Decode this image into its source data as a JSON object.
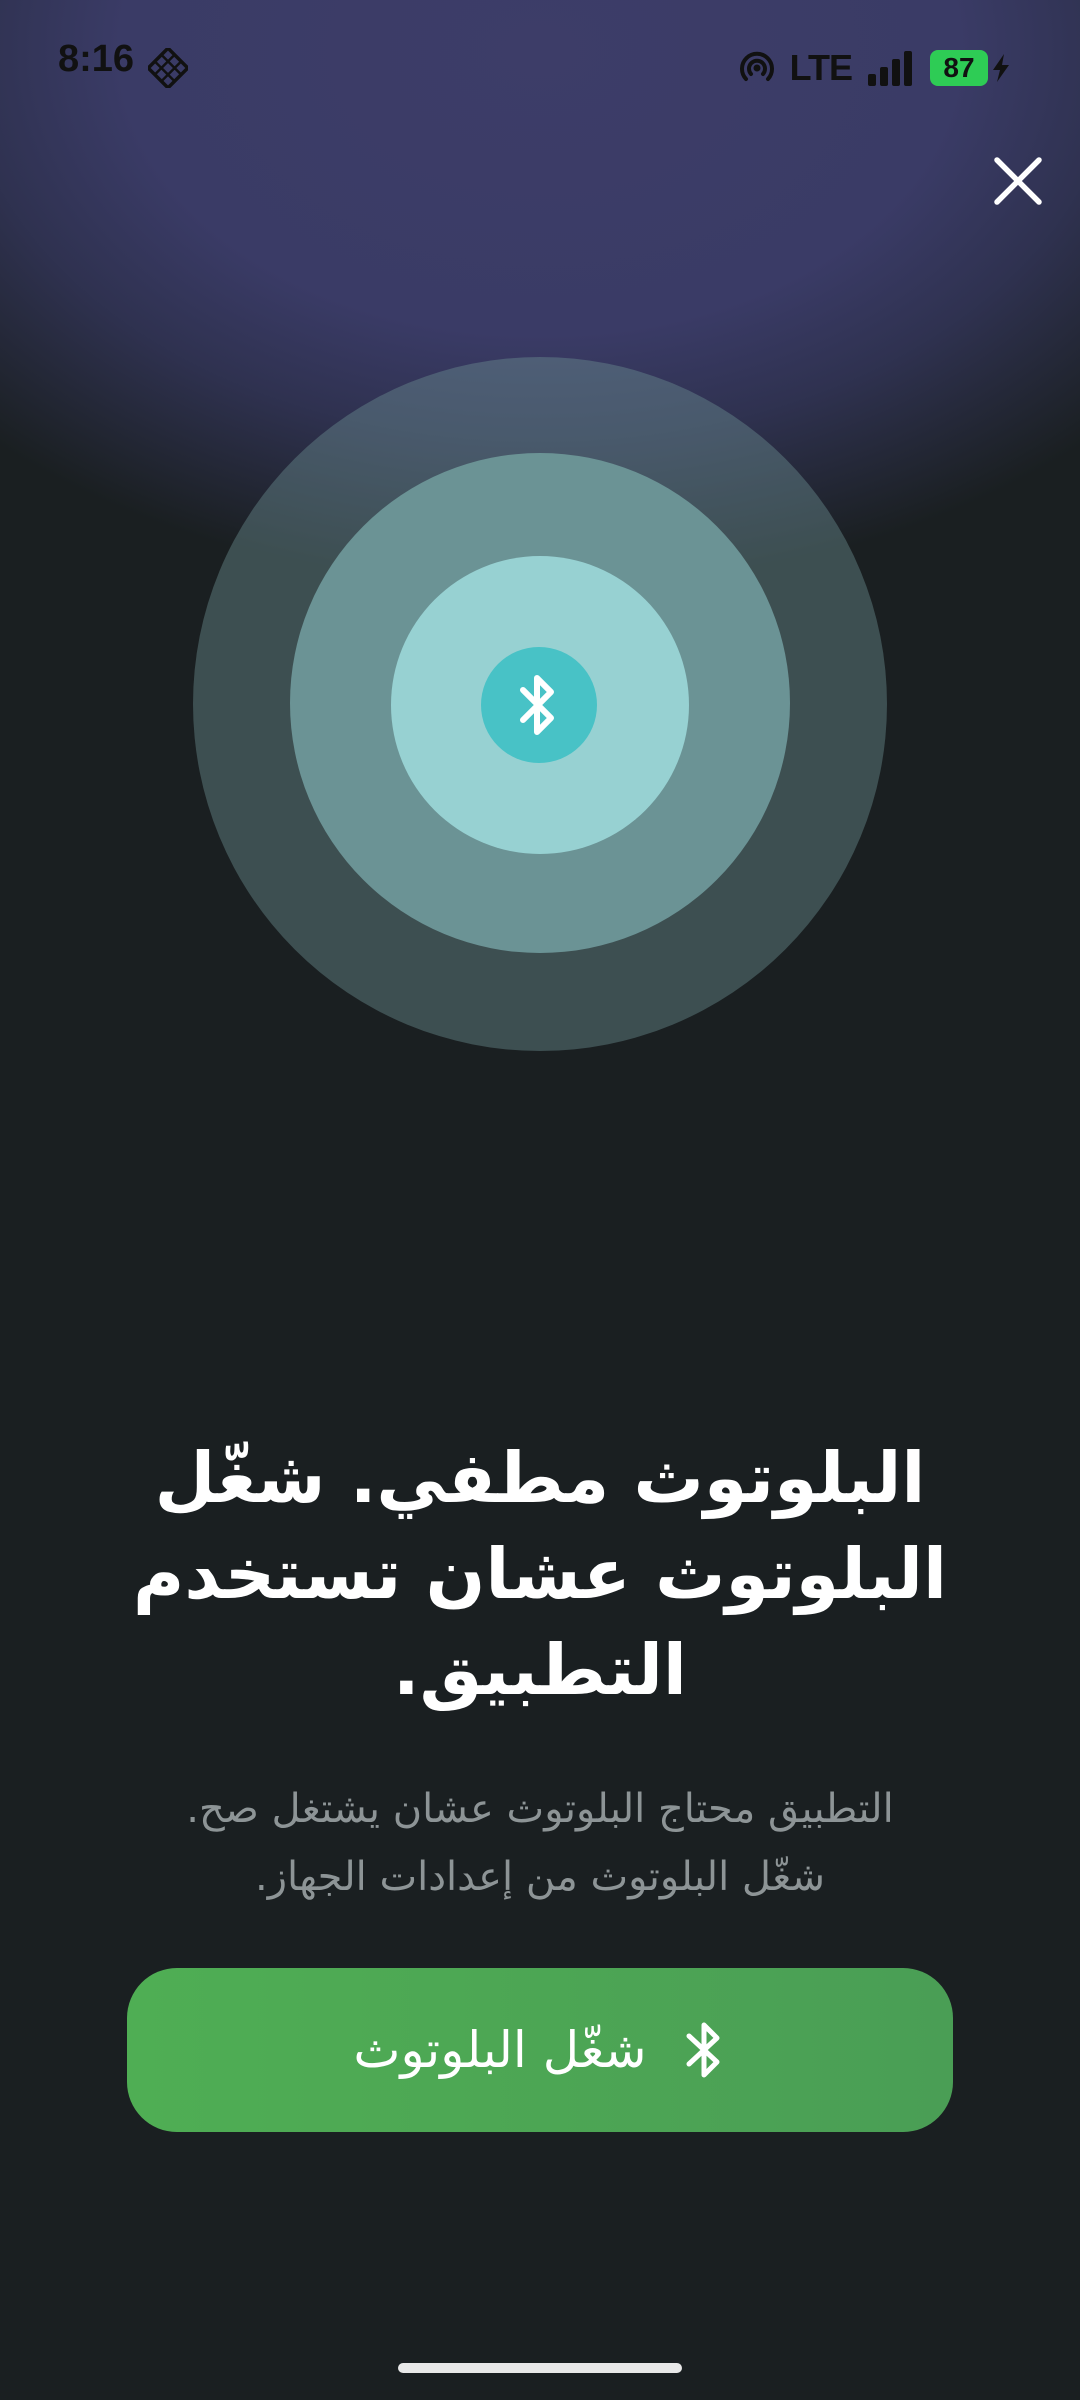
{
  "status_bar": {
    "time": "8:16",
    "network": "LTE",
    "battery_level": "87",
    "app_icon": "diamond-grid-icon",
    "hotspot_icon": "hotspot-icon",
    "signal_icon": "signal-icon",
    "charging_icon": "bolt-icon"
  },
  "close": {
    "icon": "close-icon"
  },
  "illustration": {
    "icon": "bluetooth-icon",
    "ring_colors": [
      "#4a6b6e",
      "#6b9395",
      "#97d1d2",
      "#48c2c6"
    ]
  },
  "content": {
    "headline": "البلوتوث مطفي. شغّل البلوتوث عشان تستخدم التطبيق.",
    "subtext_line1": "التطبيق محتاج البلوتوث عشان يشتغل صح.",
    "subtext_line2": "شغّل البلوتوث من إعدادات الجهاز."
  },
  "primary_button": {
    "label": "شغّل البلوتوث",
    "icon": "bluetooth-icon",
    "color": "#4caf50"
  },
  "colors": {
    "background": "#1a1f21",
    "glow": "#3a3b66",
    "text_primary": "#ffffff",
    "text_secondary": "#8d9496"
  }
}
